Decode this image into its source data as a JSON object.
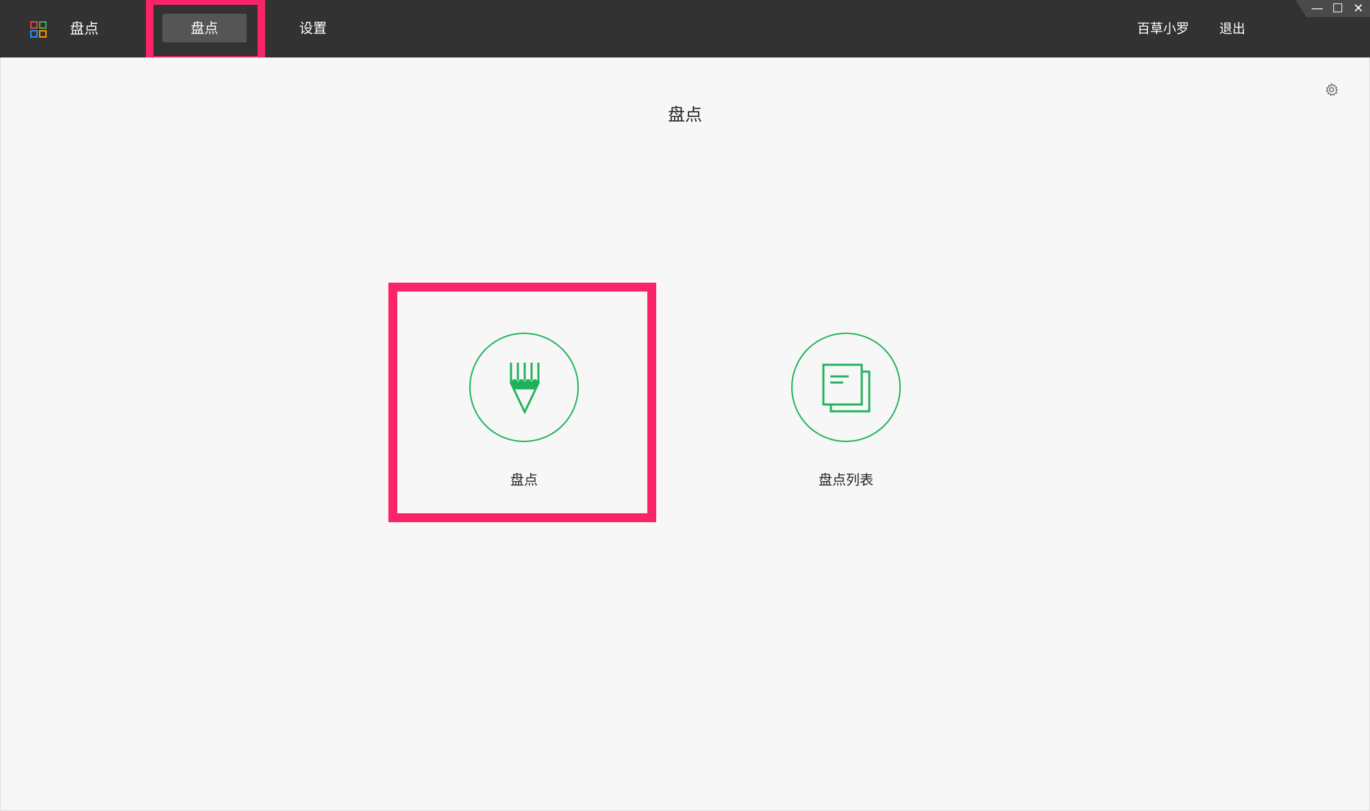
{
  "colors": {
    "topbar": "#323232",
    "active_tab": "#555555",
    "background": "#f7f7f7",
    "accent_green": "#1eb35a",
    "highlight": "#fc2468"
  },
  "header": {
    "logo_icon": "grid-logo-icon",
    "app_title": "盘点",
    "tabs": [
      {
        "label": "盘点",
        "active": true
      },
      {
        "label": "设置",
        "active": false
      }
    ],
    "user_name": "百草小罗",
    "logout_label": "退出"
  },
  "window_controls": {
    "minimize": "—",
    "maximize": "☐",
    "close": "✕"
  },
  "main": {
    "page_title": "盘点",
    "settings_icon": "gear-icon",
    "cards": [
      {
        "label": "盘点",
        "icon": "pencil-icon"
      },
      {
        "label": "盘点列表",
        "icon": "document-list-icon"
      }
    ]
  }
}
